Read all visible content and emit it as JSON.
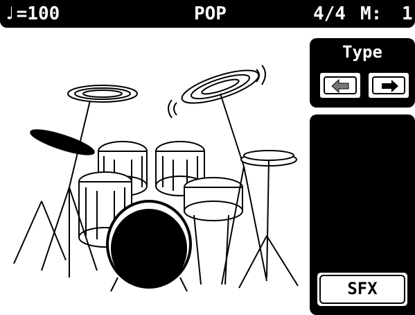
{
  "status_bar": {
    "tempo_symbol": "♩",
    "tempo_text": "=100",
    "style": "POP",
    "time_signature": "4/4",
    "measure_label": "M:",
    "measure_value": "1"
  },
  "type_panel": {
    "label": "Type",
    "prev_icon": "left-arrow-icon",
    "next_icon": "right-arrow-icon"
  },
  "sfx_panel": {
    "button_label": "SFX"
  },
  "illustration": {
    "icon": "drum-kit-icon"
  },
  "colors": {
    "background": "#ffffff",
    "foreground": "#000000"
  }
}
